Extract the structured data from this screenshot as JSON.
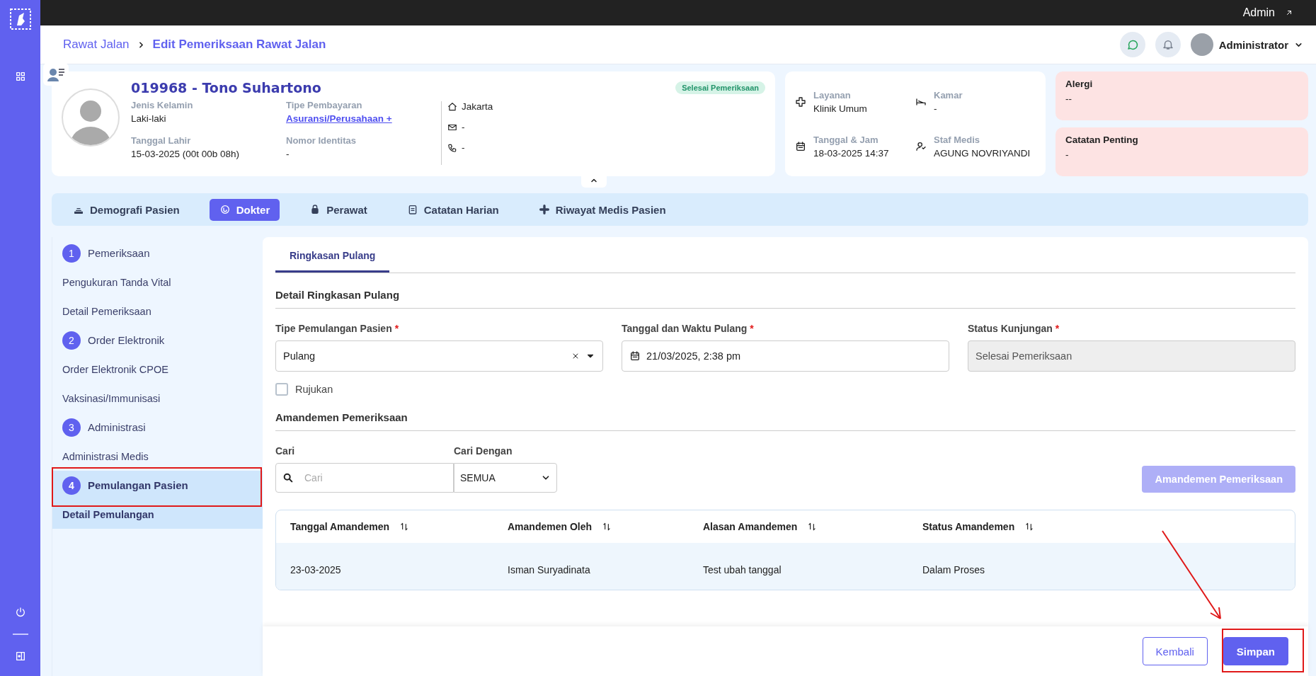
{
  "top_bar": {
    "user": "Admin"
  },
  "breadcrumb": [
    {
      "label": "Rawat Jalan",
      "selected": false
    },
    {
      "label": "Edit Pemeriksaan Rawat Jalan",
      "selected": true
    }
  ],
  "header": {
    "user": "Administrator"
  },
  "patient": {
    "title": "019968 - Tono Suhartono",
    "status": "Selesai Pemeriksaan",
    "fields": [
      {
        "label": "Jenis Kelamin",
        "value": "Laki-laki",
        "kind": "text"
      },
      {
        "label": "Tipe Pembayaran",
        "value": "Asuransi/Perusahaan +",
        "kind": "link"
      },
      {
        "label": "Tanggal Lahir",
        "value": "15-03-2025 (00t 00b 08h)",
        "kind": "text"
      },
      {
        "label": "Nomor Identitas",
        "value": "-",
        "kind": "text"
      }
    ],
    "contacts": [
      {
        "kind": "home",
        "value": "Jakarta"
      },
      {
        "kind": "mail",
        "value": "-"
      },
      {
        "kind": "phone",
        "value": "-"
      }
    ]
  },
  "visit": [
    {
      "kind": "service",
      "label": "Layanan",
      "value": "Klinik Umum"
    },
    {
      "kind": "room",
      "label": "Kamar",
      "value": "-"
    },
    {
      "kind": "date",
      "label": "Tanggal & Jam",
      "value": "18-03-2025 14:37"
    },
    {
      "kind": "staff",
      "label": "Staf Medis",
      "value": "AGUNG NOVRIYANDI"
    }
  ],
  "notes": [
    {
      "title": "Alergi",
      "value": "--"
    },
    {
      "title": "Catatan Penting",
      "value": "-"
    }
  ],
  "tabs": [
    {
      "label": "Demografi Pasien",
      "kind": "demography",
      "selected": false
    },
    {
      "label": "Dokter",
      "kind": "doctor",
      "selected": true
    },
    {
      "label": "Perawat",
      "kind": "nurse",
      "selected": false
    },
    {
      "label": "Catatan Harian",
      "kind": "notes",
      "selected": false
    },
    {
      "label": "Riwayat Medis Pasien",
      "kind": "history",
      "selected": false
    }
  ],
  "steps": [
    {
      "number": "1",
      "label": "Pemeriksaan",
      "selected": false,
      "children": [
        {
          "label": "Pengukuran Tanda Vital",
          "selected": false
        },
        {
          "label": "Detail Pemeriksaan",
          "selected": false
        }
      ]
    },
    {
      "number": "2",
      "label": "Order Elektronik",
      "selected": false,
      "children": [
        {
          "label": "Order Elektronik CPOE",
          "selected": false
        },
        {
          "label": "Vaksinasi/Immunisasi",
          "selected": false
        }
      ]
    },
    {
      "number": "3",
      "label": "Administrasi",
      "selected": false,
      "children": [
        {
          "label": "Administrasi Medis",
          "selected": false
        }
      ]
    },
    {
      "number": "4",
      "label": "Pemulangan Pasien",
      "selected": true,
      "children": [
        {
          "label": "Detail Pemulangan",
          "selected": true
        }
      ]
    }
  ],
  "form": {
    "tabs": [
      {
        "label": "Ringkasan Pulang",
        "selected": true
      }
    ],
    "section_title": "Detail Ringkasan Pulang",
    "fields": [
      {
        "kind": "select",
        "label": "Tipe Pemulangan Pasien",
        "mark": "*",
        "value": "Pulang"
      },
      {
        "kind": "date",
        "label": "Tanggal dan Waktu Pulang",
        "mark": "*",
        "value": "21/03/2025, 2:38 pm"
      },
      {
        "kind": "readonly",
        "label": "Status Kunjungan",
        "mark": "*",
        "value": "Selesai Pemeriksaan"
      }
    ],
    "checkbox": {
      "label": "Rujukan",
      "checked": false
    }
  },
  "amendments": {
    "title": "Amandemen Pemeriksaan",
    "search": {
      "label": "Cari",
      "placeholder": "Cari"
    },
    "filter": {
      "label": "Cari Dengan",
      "value": "SEMUA"
    },
    "button": {
      "label": "Amandemen Pemeriksaan",
      "disabled": true
    },
    "table": {
      "columns": [
        "Tanggal Amandemen",
        "Amandemen Oleh",
        "Alasan Amandemen",
        "Status Amandemen"
      ],
      "rows": [
        [
          "23-03-2025",
          "Isman Suryadinata",
          "Test ubah tanggal",
          "Dalam Proses"
        ]
      ]
    }
  },
  "footer": {
    "buttons": [
      {
        "label": "Kembali",
        "kind": "secondary"
      },
      {
        "label": "Simpan",
        "kind": "primary"
      }
    ]
  }
}
